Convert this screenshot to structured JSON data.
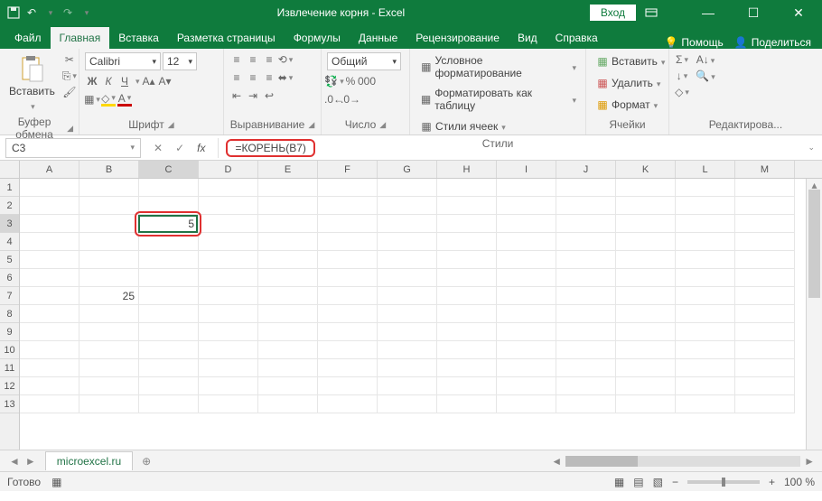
{
  "titlebar": {
    "title": "Извлечение корня  -  Excel",
    "login": "Вход"
  },
  "tabs": {
    "file": "Файл",
    "home": "Главная",
    "insert": "Вставка",
    "layout": "Разметка страницы",
    "formulas": "Формулы",
    "data": "Данные",
    "review": "Рецензирование",
    "view": "Вид",
    "help": "Справка",
    "tellme": "Помощь",
    "share": "Поделиться"
  },
  "ribbon": {
    "clipboard": {
      "paste": "Вставить",
      "label": "Буфер обмена"
    },
    "font": {
      "name": "Calibri",
      "size": "12",
      "label": "Шрифт"
    },
    "align": {
      "label": "Выравнивание"
    },
    "number": {
      "format": "Общий",
      "label": "Число"
    },
    "styles": {
      "cond": "Условное форматирование",
      "table": "Форматировать как таблицу",
      "cell": "Стили ячеек",
      "label": "Стили"
    },
    "cells": {
      "insert": "Вставить",
      "delete": "Удалить",
      "format": "Формат",
      "label": "Ячейки"
    },
    "editing": {
      "label": "Редактирова..."
    }
  },
  "formula_bar": {
    "name_box": "C3",
    "formula": "=КОРЕНЬ(B7)"
  },
  "columns": [
    "A",
    "B",
    "C",
    "D",
    "E",
    "F",
    "G",
    "H",
    "I",
    "J",
    "K",
    "L",
    "M"
  ],
  "rows": [
    "1",
    "2",
    "3",
    "4",
    "5",
    "6",
    "7",
    "8",
    "9",
    "10",
    "11",
    "12",
    "13"
  ],
  "cell_data": {
    "C3": "5",
    "B7": "25"
  },
  "sheet": {
    "name": "microexcel.ru"
  },
  "status": {
    "ready": "Готово",
    "zoom": "100 %"
  }
}
